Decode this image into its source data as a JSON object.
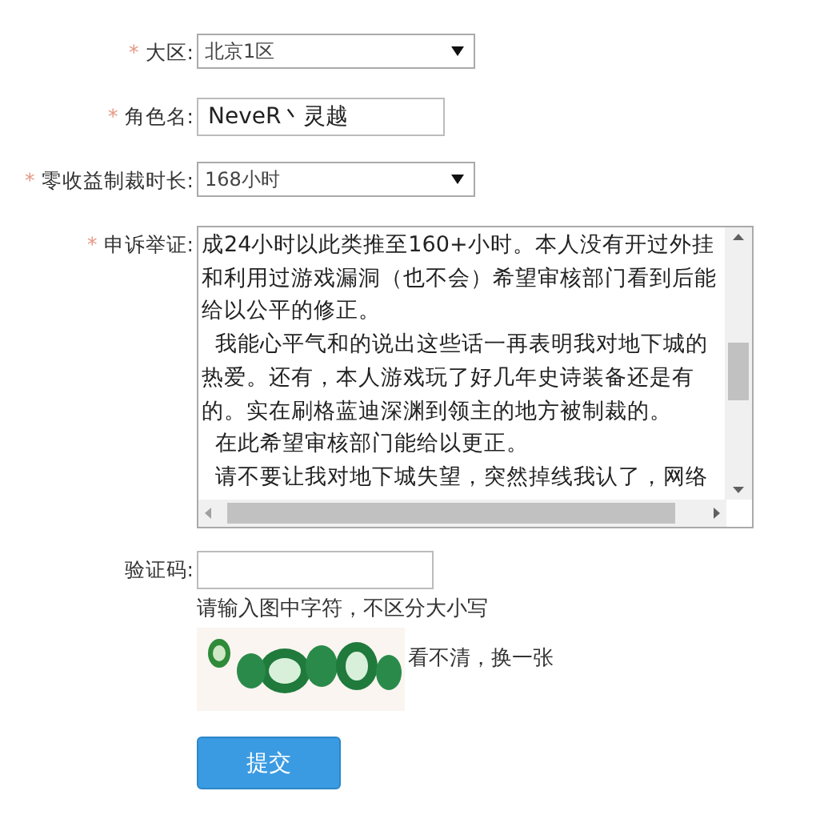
{
  "fields": [
    {
      "kind": "select",
      "marker": "*",
      "label": "大区:",
      "value": "北京1区"
    },
    {
      "kind": "text",
      "marker": "*",
      "label": "角色名:",
      "value": "NeveR丶灵越"
    },
    {
      "kind": "select",
      "marker": "*",
      "label": "零收益制裁时长:",
      "value": "168小时"
    },
    {
      "kind": "textarea",
      "marker": "*",
      "label": "申诉举证:",
      "lines": [
        "成24小时以此类推至160+小时。本人没有开过外挂",
        "和利用过游戏漏洞（也不会）希望审核部门看到后能",
        "给以公平的修正。",
        "  我能心平气和的说出这些话一再表明我对地下城的",
        "热爱。还有，本人游戏玩了好几年史诗装备还是有",
        "的。实在刷格蓝迪深渊到领主的地方被制裁的。",
        "  在此希望审核部门能给以更正。",
        "  请不要让我对地下城失望，突然掉线我认了，网络"
      ]
    },
    {
      "kind": "captcha",
      "label": "验证码:",
      "hint": "请输入图中字符，不区分大小写",
      "refresh": "看不清，换一张"
    }
  ],
  "submit": "提交"
}
